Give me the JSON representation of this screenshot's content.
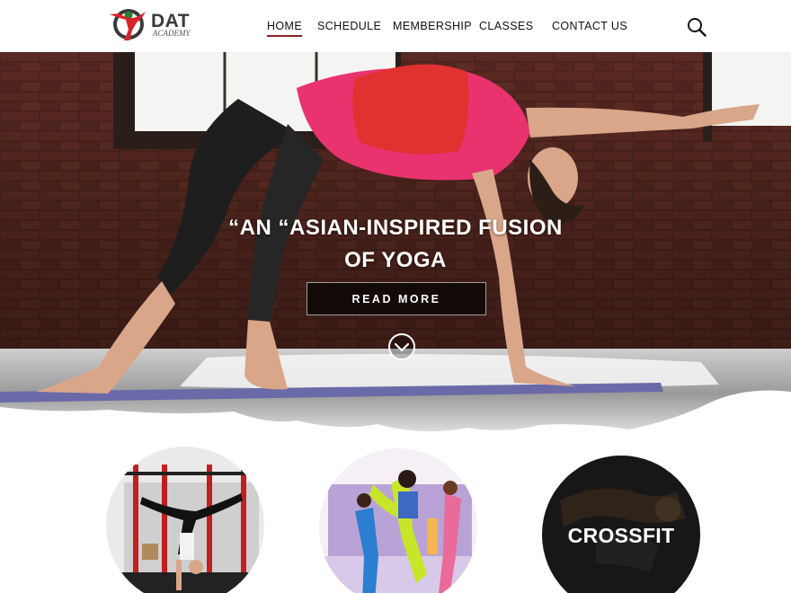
{
  "brand": {
    "name": "DAT",
    "tagline": "ACADEMY",
    "colors": {
      "red": "#d8232a",
      "green": "#2e7d32",
      "dark": "#3a3a3a"
    }
  },
  "nav": {
    "items": [
      {
        "label": "HOME",
        "active": true
      },
      {
        "label": "SCHEDULE",
        "active": false
      },
      {
        "label": "MEMBERSHIP",
        "active": false
      },
      {
        "label": "CLASSES",
        "active": false
      },
      {
        "label": "CONTACT US",
        "active": false
      }
    ],
    "active_color": "#8a1f1f",
    "search_icon": "search-icon"
  },
  "hero": {
    "title_line1": "“AN “ASIAN-INSPIRED FUSION",
    "title_line2": "OF YOGA",
    "button_label": "READ MORE",
    "scroll_icon": "chevron-down-circle-icon"
  },
  "classes": [
    {
      "image": "gym-handstand",
      "label": ""
    },
    {
      "image": "dance-group",
      "label": ""
    },
    {
      "image": "crossfit",
      "label": "CROSSFIT"
    }
  ]
}
